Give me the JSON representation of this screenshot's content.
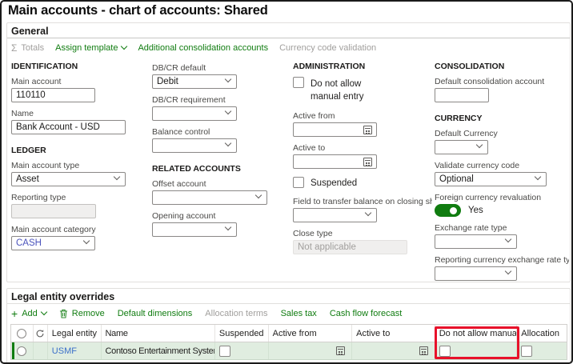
{
  "page": {
    "title": "Main accounts - chart of accounts: Shared"
  },
  "icons": {
    "sigma": "Σ",
    "plus": "+"
  },
  "colors": {
    "accent_green": "#107C10",
    "disabled_gray": "#A19F9D",
    "category_link": "#4B53BC",
    "grid_link": "#3B6FC9",
    "selected_row_bg": "#E0EDE0",
    "annotation_red": "#E8112A"
  },
  "general": {
    "header": "General",
    "toolbar": {
      "totals": "Totals",
      "assign_template": "Assign template",
      "additional_consolidation_accounts": "Additional consolidation accounts",
      "currency_code_validation": "Currency code validation"
    },
    "identification": {
      "header": "IDENTIFICATION",
      "main_account": {
        "label": "Main account",
        "value": "110110"
      },
      "name": {
        "label": "Name",
        "value": "Bank Account - USD"
      }
    },
    "ledger": {
      "header": "LEDGER",
      "main_account_type": {
        "label": "Main account type",
        "value": "Asset"
      },
      "reporting_type": {
        "label": "Reporting type",
        "value": ""
      },
      "main_account_category": {
        "label": "Main account category",
        "value": "CASH"
      }
    },
    "posting": {
      "db_cr_default": {
        "label": "DB/CR default",
        "value": "Debit"
      },
      "db_cr_requirement": {
        "label": "DB/CR requirement",
        "value": ""
      },
      "balance_control": {
        "label": "Balance control",
        "value": ""
      }
    },
    "related_accounts": {
      "header": "RELATED ACCOUNTS",
      "offset_account": {
        "label": "Offset account",
        "value": ""
      },
      "opening_account": {
        "label": "Opening account",
        "value": ""
      }
    },
    "administration": {
      "header": "ADMINISTRATION",
      "do_not_allow_manual_entry": {
        "label": "Do not allow manual entry",
        "checked": false
      },
      "active_from": {
        "label": "Active from",
        "value": ""
      },
      "active_to": {
        "label": "Active to",
        "value": ""
      },
      "suspended": {
        "label": "Suspended",
        "checked": false
      },
      "field_to_transfer": {
        "label": "Field to transfer balance on closing sh...",
        "value": ""
      },
      "close_type": {
        "label": "Close type",
        "value": "Not applicable"
      }
    },
    "consolidation": {
      "header": "CONSOLIDATION",
      "default_consolidation_account": {
        "label": "Default consolidation account",
        "value": ""
      }
    },
    "currency": {
      "header": "CURRENCY",
      "default_currency": {
        "label": "Default Currency",
        "value": ""
      },
      "validate_currency_code": {
        "label": "Validate currency code",
        "value": "Optional"
      },
      "foreign_currency_revaluation": {
        "label": "Foreign currency revaluation",
        "value": "Yes",
        "on": true
      },
      "exchange_rate_type": {
        "label": "Exchange rate type",
        "value": ""
      },
      "reporting_currency_exchange_rate_type": {
        "label": "Reporting currency exchange rate type",
        "value": ""
      }
    }
  },
  "overrides": {
    "header": "Legal entity overrides",
    "toolbar": {
      "add": "Add",
      "remove": "Remove",
      "default_dimensions": "Default dimensions",
      "allocation_terms": "Allocation terms",
      "sales_tax": "Sales tax",
      "cash_flow_forecast": "Cash flow forecast"
    },
    "grid": {
      "columns": [
        "Legal entity",
        "Name",
        "Suspended",
        "Active from",
        "Active to",
        "Do not allow manual entry",
        "Allocation"
      ],
      "rows": [
        {
          "legal_entity": "USMF",
          "name": "Contoso Entertainment System ...",
          "suspended": false,
          "do_not_allow_manual_entry": false,
          "allocation": false,
          "selected": true
        }
      ]
    },
    "annotation": {
      "highlighted_column": "Do not allow manual entry"
    }
  }
}
